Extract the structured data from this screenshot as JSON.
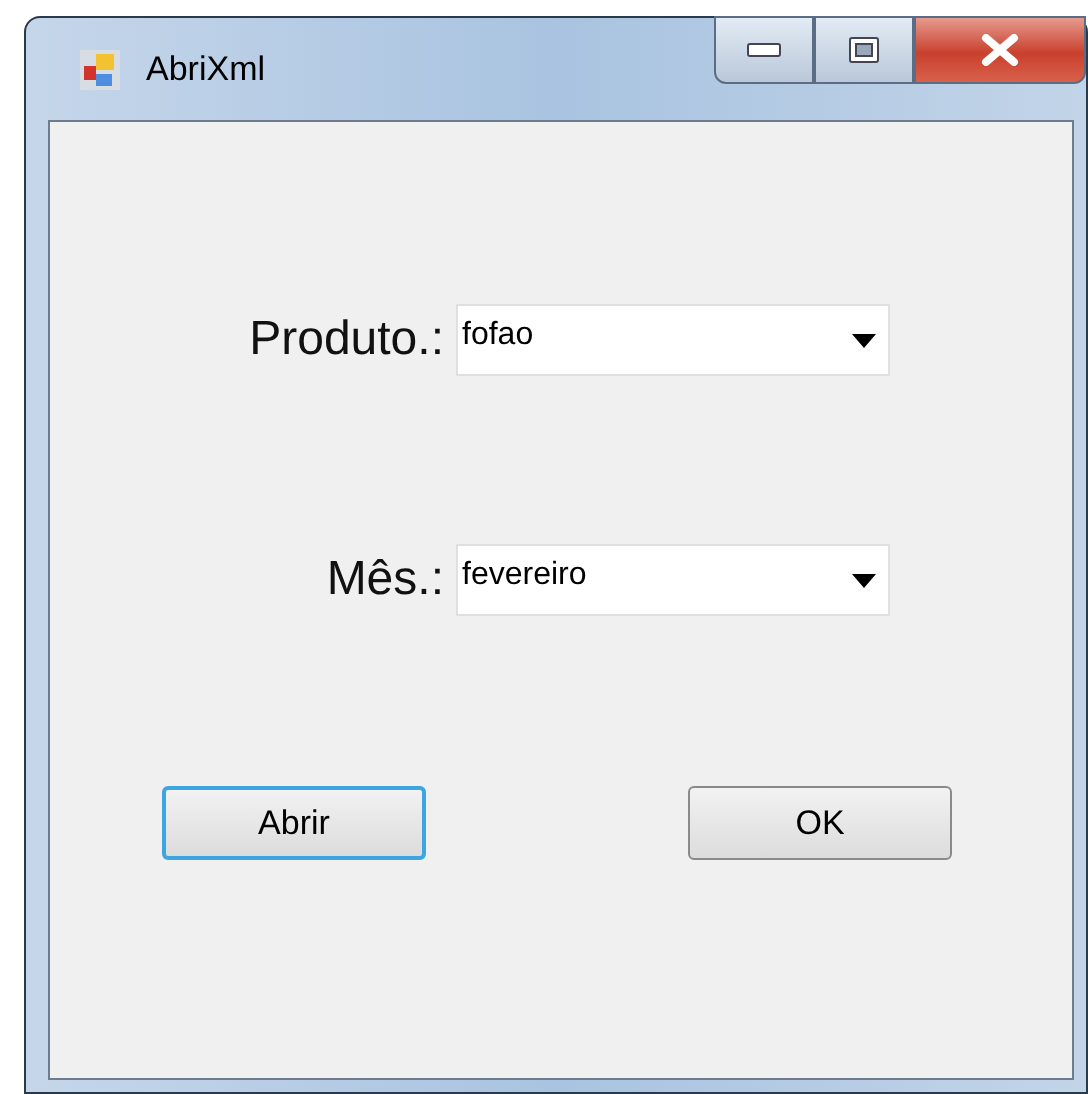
{
  "window": {
    "title": "AbriXml"
  },
  "fields": [
    {
      "label": "Produto.:",
      "value": "fofao"
    },
    {
      "label": "Mês.:",
      "value": "fevereiro"
    }
  ],
  "buttons": [
    {
      "label": "Abrir",
      "focused": true
    },
    {
      "label": "OK",
      "focused": false
    }
  ]
}
